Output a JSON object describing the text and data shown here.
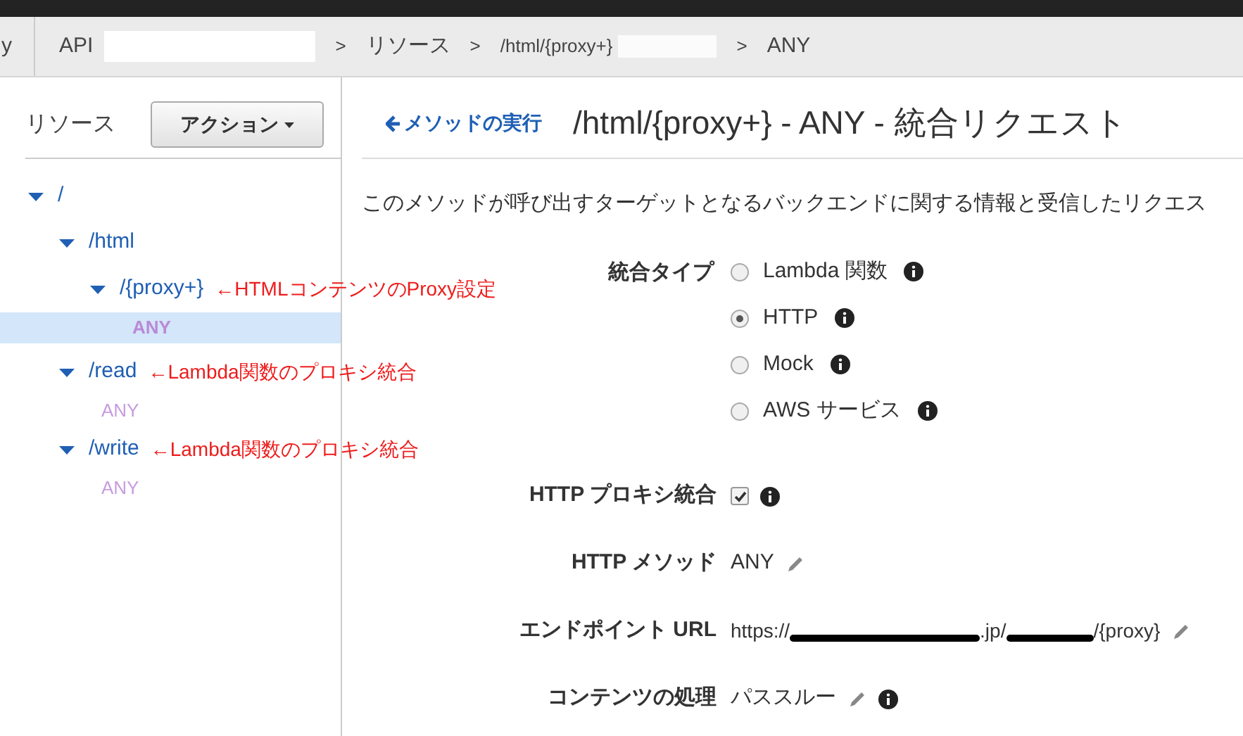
{
  "breadcrumb": {
    "cut_item": "y",
    "separator": ">",
    "items": [
      {
        "label": "API",
        "redacted_after": true
      },
      {
        "label": "リソース",
        "redacted_after": false
      },
      {
        "label": "/html/{proxy+}",
        "redacted_after": true
      },
      {
        "label": "ANY",
        "redacted_after": false
      }
    ]
  },
  "sidebar": {
    "title": "リソース",
    "action_button": "アクション",
    "tree": [
      {
        "label": "/",
        "expanded": true,
        "children": [
          {
            "label": "/html",
            "expanded": true,
            "children": [
              {
                "label": "/{proxy+}",
                "expanded": true,
                "note": "←HTMLコンテンツのProxy設定",
                "methods": [
                  {
                    "label": "ANY",
                    "selected": true
                  }
                ]
              }
            ]
          },
          {
            "label": "/read",
            "expanded": true,
            "note": "←Lambda関数のプロキシ統合",
            "methods": [
              {
                "label": "ANY",
                "selected": false
              }
            ]
          },
          {
            "label": "/write",
            "expanded": true,
            "note": "←Lambda関数のプロキシ統合",
            "methods": [
              {
                "label": "ANY",
                "selected": false
              }
            ]
          }
        ]
      }
    ]
  },
  "main": {
    "back_link": "メソッドの実行",
    "title": "/html/{proxy+} - ANY - 統合リクエスト",
    "description": "このメソッドが呼び出すターゲットとなるバックエンドに関する情報と受信したリクエス",
    "integration_type": {
      "label": "統合タイプ",
      "options": [
        {
          "label": "Lambda 関数",
          "selected": false
        },
        {
          "label": "HTTP",
          "selected": true
        },
        {
          "label": "Mock",
          "selected": false
        },
        {
          "label": "AWS サービス",
          "selected": false
        }
      ]
    },
    "fields": [
      {
        "kind": "checkbox",
        "label": "HTTP プロキシ統合",
        "checked": true,
        "info": true
      },
      {
        "kind": "text",
        "label": "HTTP メソッド",
        "value": "ANY",
        "editable": true
      },
      {
        "kind": "url",
        "label": "エンドポイント URL",
        "parts": [
          "https://",
          ".jp/",
          "/{proxy}"
        ],
        "editable": true
      },
      {
        "kind": "text",
        "label": "コンテンツの処理",
        "value": "パススルー",
        "editable": true,
        "info": true
      }
    ]
  }
}
